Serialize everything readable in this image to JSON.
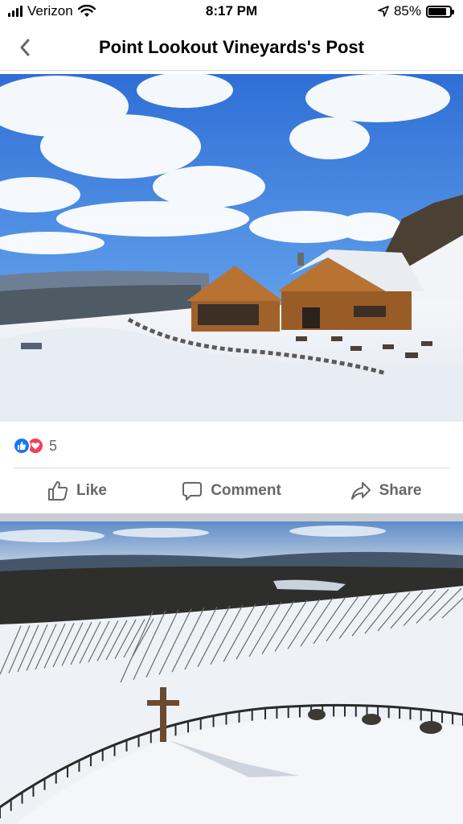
{
  "status_bar": {
    "carrier": "Verizon",
    "time": "8:17 PM",
    "battery_percent": "85%",
    "battery_level": 0.85
  },
  "header": {
    "title": "Point Lookout Vineyards's Post",
    "back_icon": "chevron-left-icon"
  },
  "post": {
    "reactions": {
      "icons": [
        "like-icon",
        "love-icon"
      ],
      "count": "5"
    },
    "actions": [
      {
        "label": "Like",
        "icon": "thumbs-up-icon"
      },
      {
        "label": "Comment",
        "icon": "comment-icon"
      },
      {
        "label": "Share",
        "icon": "share-icon"
      }
    ]
  },
  "colors": {
    "like_blue": "#1877f2",
    "love_red": "#f33e58",
    "action_gray": "#65676b",
    "divider": "#dadde1",
    "separator": "#c9ccd1"
  }
}
